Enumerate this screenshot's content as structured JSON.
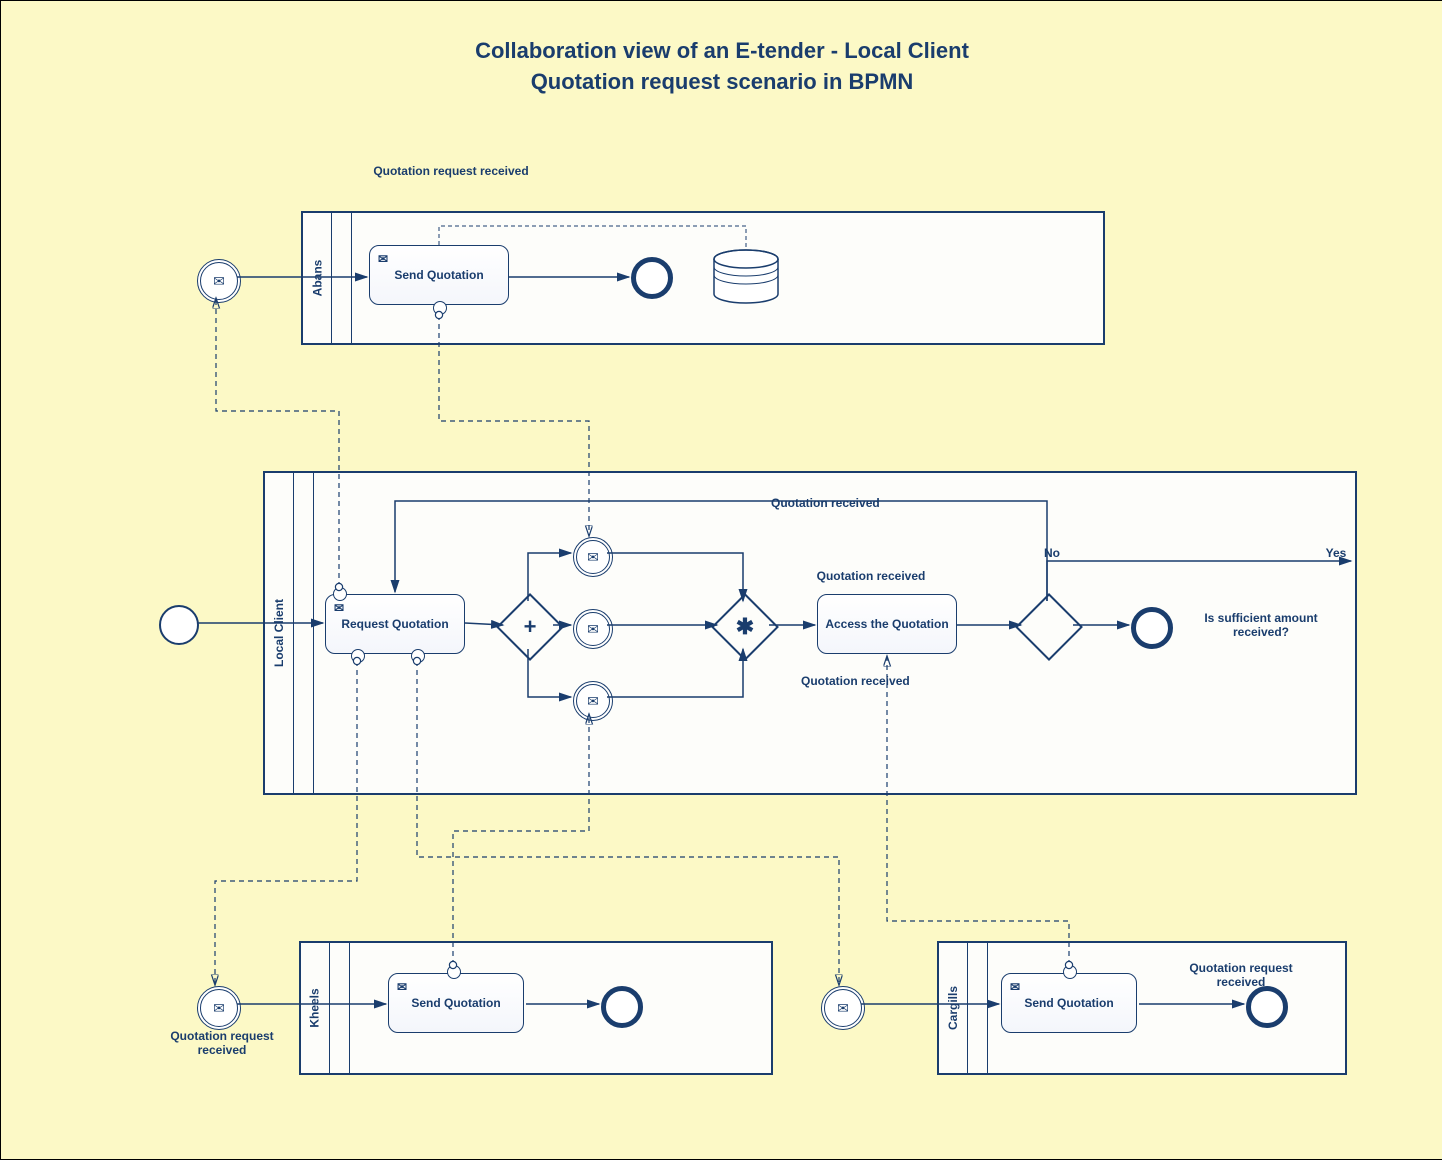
{
  "title_line1": "Collaboration view of an E-tender - Local Client",
  "title_line2": "Quotation request scenario in BPMN",
  "pools": {
    "abans": {
      "name": "Abans"
    },
    "local_client": {
      "name": "Local Client"
    },
    "kheels": {
      "name": "Kheels"
    },
    "cargills": {
      "name": "Cargills"
    }
  },
  "tasks": {
    "abans_send": "Send Quotation",
    "request_quotation": "Request Quotation",
    "access_quotation": "Access the Quotation",
    "kheels_send": "Send Quotation",
    "cargills_send": "Send Quotation"
  },
  "labels": {
    "abans_qr_received": "Quotation request received",
    "kheels_qr_received": "Quotation request received",
    "cargills_qr_received": "Quotation request received",
    "quotation_received_top": "Quotation received",
    "quotation_received_mid": "Quotation received",
    "quotation_received_bot": "Quotation received",
    "no": "No",
    "yes": "Yes",
    "sufficient": "Is sufficient amount received?"
  }
}
